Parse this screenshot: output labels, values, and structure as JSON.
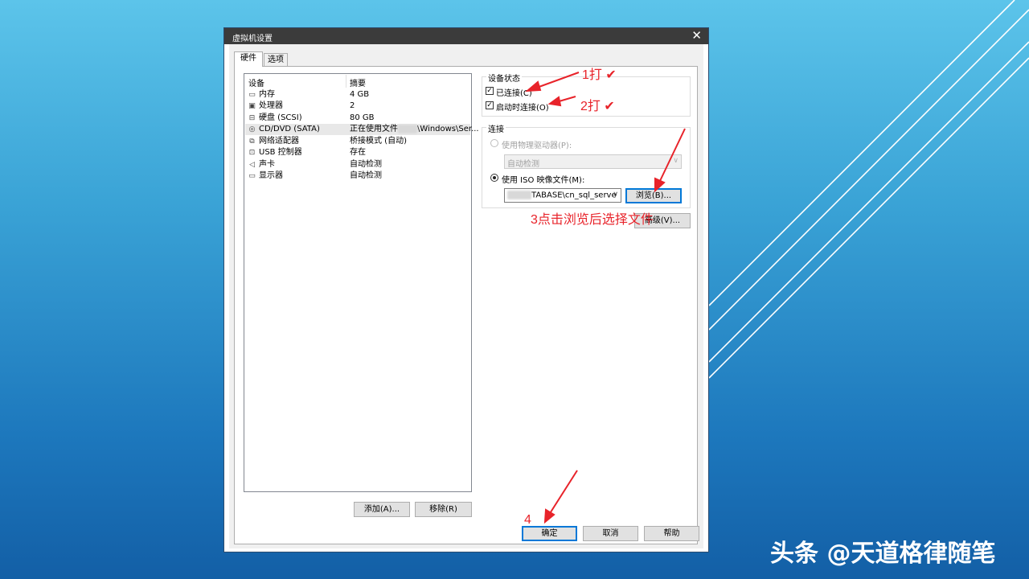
{
  "window": {
    "title": "虚拟机设置",
    "close_label": "✕"
  },
  "tabs": [
    {
      "label": "硬件",
      "active": true
    },
    {
      "label": "选项",
      "active": false
    }
  ],
  "device_list": {
    "headers": [
      "设备",
      "摘要"
    ],
    "rows": [
      {
        "icon": "memory-icon",
        "name": "内存",
        "summary": "4 GB"
      },
      {
        "icon": "processor-icon",
        "name": "处理器",
        "summary": "2"
      },
      {
        "icon": "hard-disk-icon",
        "name": "硬盘 (SCSI)",
        "summary": "80 GB"
      },
      {
        "icon": "cd-dvd-icon",
        "name": "CD/DVD (SATA)",
        "summary_prefix": "正在使用文件",
        "summary_suffix": "\\Windows\\Ser...",
        "selected": true
      },
      {
        "icon": "network-adapter-icon",
        "name": "网络适配器",
        "summary": "桥接模式 (自动)"
      },
      {
        "icon": "usb-controller-icon",
        "name": "USB 控制器",
        "summary": "存在"
      },
      {
        "icon": "sound-card-icon",
        "name": "声卡",
        "summary": "自动检测"
      },
      {
        "icon": "display-icon",
        "name": "显示器",
        "summary": "自动检测"
      }
    ]
  },
  "list_buttons": {
    "add": "添加(A)...",
    "remove": "移除(R)"
  },
  "device_status": {
    "title": "设备状态",
    "connected": {
      "label": "已连接(C)",
      "checked": true
    },
    "connect_at_power_on": {
      "label": "启动时连接(O)",
      "checked": true
    }
  },
  "connection": {
    "title": "连接",
    "physical_drive": {
      "label": "使用物理驱动器(P):",
      "selected": false,
      "value": "自动检测"
    },
    "iso_image": {
      "label": "使用 ISO 映像文件(M):",
      "selected": true,
      "value": "TABASE\\cn_sql_serve"
    },
    "browse": "浏览(B)..."
  },
  "advanced_button": "高级(V)...",
  "dialog_buttons": {
    "ok": "确定",
    "cancel": "取消",
    "help": "帮助"
  },
  "annotations": {
    "step1": "1打",
    "step2": "2打",
    "step3": "3点击浏览后选择文件",
    "step4": "4",
    "check_mark": "✔",
    "color": "#e8232a"
  },
  "watermark": "头条 @天道格律随笔",
  "colors": {
    "background_top": "#5cc4ea",
    "background_bottom": "#135fa6",
    "titlebar": "#3b3b3b",
    "annotation": "#e8232a",
    "focus_blue": "#0078d7"
  }
}
